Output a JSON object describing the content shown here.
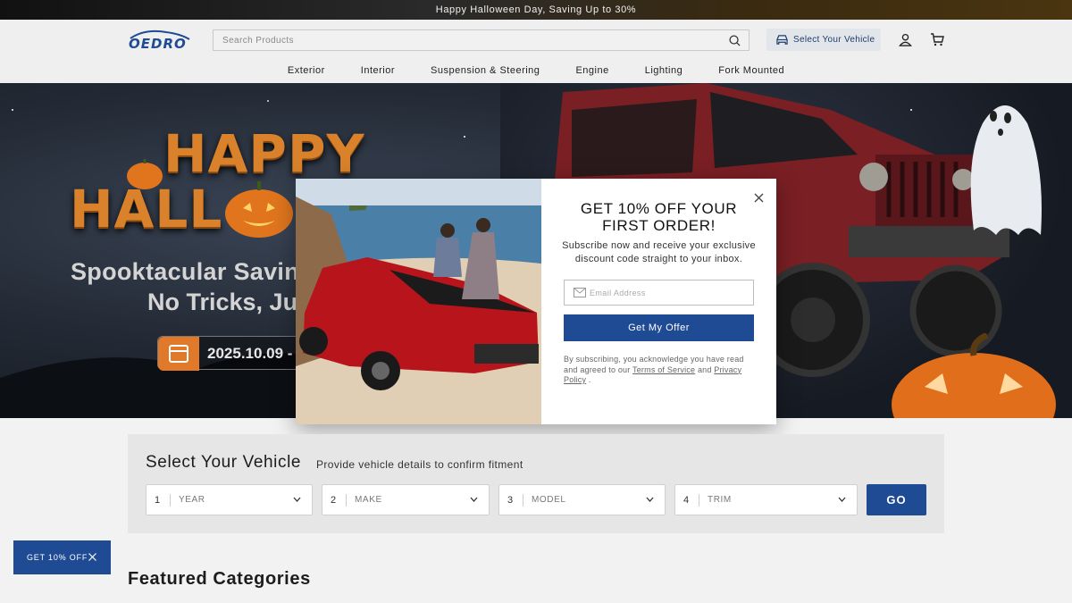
{
  "announcement": "Happy Halloween Day, Saving Up to 30%",
  "header": {
    "logo_text": "OEDRO",
    "search_placeholder": "Search Products",
    "select_vehicle": "Select Your Vehicle",
    "icons": [
      "search-icon",
      "car-icon",
      "account-icon",
      "cart-icon"
    ]
  },
  "nav": [
    "Exterior",
    "Interior",
    "Suspension & Steering",
    "Engine",
    "Lighting",
    "Fork Mounted"
  ],
  "hero": {
    "title_line1": "HAPPY",
    "title_line2": "HALL",
    "subtitle_line1": "Spooktacular Saving",
    "subtitle_line2": "No Tricks, Jus",
    "date": "2025.10.09 -"
  },
  "popup": {
    "title": "GET 10% OFF YOUR FIRST ORDER!",
    "subtitle": "Subscribe now and receive your exclusive discount code straight to your inbox.",
    "email_placeholder": "Email Address",
    "button": "Get My Offer",
    "legal_prefix": "By subscribing, you acknowledge you have read and agreed to our",
    "terms": "Terms of Service",
    "and": "and",
    "privacy": "Privacy Policy",
    "suffix": "."
  },
  "vehicle_selector": {
    "title": "Select Your Vehicle",
    "subtitle": "Provide vehicle details to confirm fitment",
    "fields": [
      {
        "num": "1",
        "label": "YEAR"
      },
      {
        "num": "2",
        "label": "MAKE"
      },
      {
        "num": "3",
        "label": "MODEL"
      },
      {
        "num": "4",
        "label": "TRIM"
      }
    ],
    "go": "GO"
  },
  "float_badge": "GET 10% OFF",
  "featured_title": "Featured Categories",
  "colors": {
    "primary": "#1f4b95",
    "accent_orange": "#d9822b",
    "vehicle_red": "#8b1e22"
  }
}
